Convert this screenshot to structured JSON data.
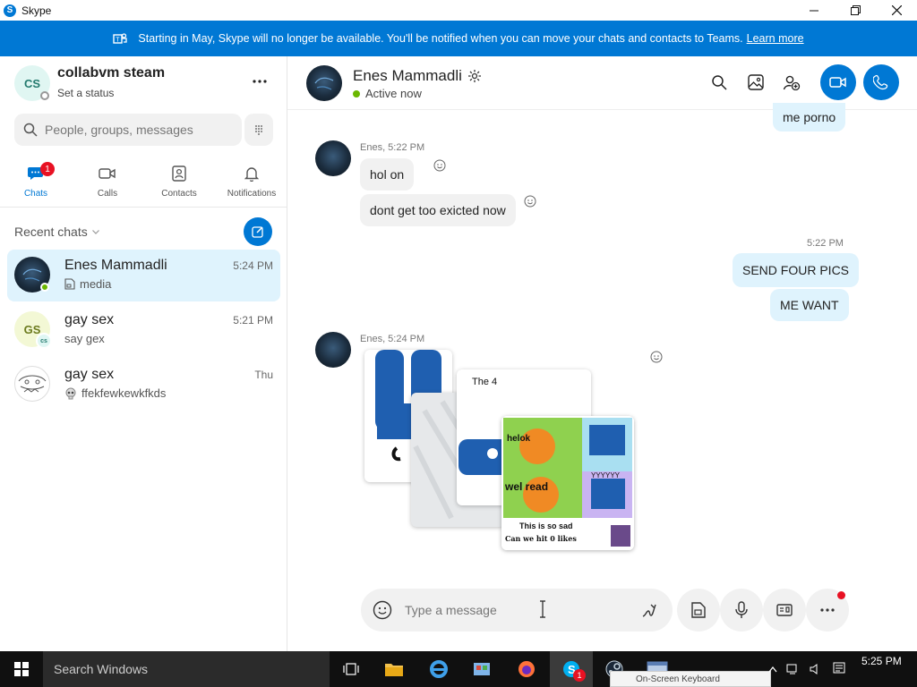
{
  "window": {
    "title": "Skype",
    "logo_letter": "S"
  },
  "banner": {
    "text": "Starting in May, Skype will no longer be available. You'll be notified when you can move your chats and contacts to Teams.",
    "link": "Learn more"
  },
  "profile": {
    "initials": "CS",
    "name": "collabvm steam",
    "status": "Set a status"
  },
  "search": {
    "placeholder": "People, groups, messages"
  },
  "nav": {
    "tabs": [
      {
        "label": "Chats",
        "badge": "1"
      },
      {
        "label": "Calls"
      },
      {
        "label": "Contacts"
      },
      {
        "label": "Notifications"
      }
    ]
  },
  "recent": {
    "label": "Recent chats"
  },
  "chats": [
    {
      "name": "Enes Mammadli",
      "time": "5:24 PM",
      "preview": "media"
    },
    {
      "name": "gay sex",
      "time": "5:21 PM",
      "preview": "say gex",
      "initials": "GS",
      "sub_initials": "cs"
    },
    {
      "name": "gay sex",
      "time": "Thu",
      "preview": "ffekfewkewkfkds"
    }
  ],
  "conversation": {
    "name": "Enes Mammadli",
    "status": "Active now",
    "messages": {
      "out_top": "me porno",
      "meta1": "Enes, 5:22 PM",
      "in1": "hol on",
      "in2": "dont get too exicted now",
      "meta2": "5:22 PM",
      "out1": "SEND FOUR PICS",
      "out2": "ME WANT",
      "meta3": "Enes, 5:24 PM"
    },
    "media": {
      "card_title": "The 4",
      "meme_top": "helok",
      "meme_mid": "wel read",
      "meme_caption": "This is so sad",
      "meme_bottom": "Can we hit   0 likes",
      "meme_bubble": "YYYYYY"
    }
  },
  "composer": {
    "placeholder": "Type a message"
  },
  "taskbar": {
    "search": "Search Windows",
    "time": "5:25 PM",
    "skype_badge": "1",
    "popup": "On-Screen Keyboard"
  },
  "colors": {
    "accent": "#0078d4",
    "bubble_out": "#dff3fd",
    "bubble_in": "#f1f1f1",
    "online": "#6bb700",
    "badge": "#e81123"
  }
}
